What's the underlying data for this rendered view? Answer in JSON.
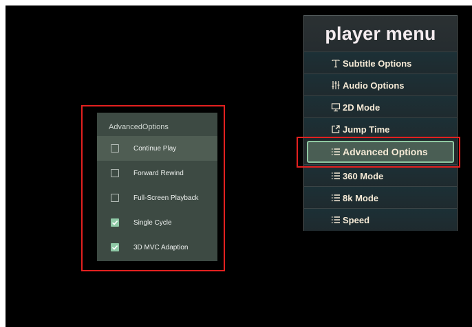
{
  "advanced_options": {
    "title": "AdvancedOptions",
    "items": [
      {
        "label": "Continue Play",
        "checked": false,
        "selected": true
      },
      {
        "label": "Forward Rewind",
        "checked": false,
        "selected": false
      },
      {
        "label": "Full-Screen Playback",
        "checked": false,
        "selected": false
      },
      {
        "label": "Single Cycle",
        "checked": true,
        "selected": false
      },
      {
        "label": "3D MVC Adaption",
        "checked": true,
        "selected": false
      }
    ]
  },
  "player_menu": {
    "title": "player menu",
    "items": [
      {
        "label": "Subtitle Options",
        "icon": "text-t-icon"
      },
      {
        "label": "Audio Options",
        "icon": "equalizer-icon"
      },
      {
        "label": "2D Mode",
        "icon": "monitor-icon"
      },
      {
        "label": "Jump Time",
        "icon": "external-link-icon"
      },
      {
        "label": "Advanced Options",
        "icon": "list-icon",
        "active": true
      },
      {
        "label": "360 Mode",
        "icon": "list-icon"
      },
      {
        "label": "8k Mode",
        "icon": "list-icon"
      },
      {
        "label": "Speed",
        "icon": "list-icon"
      }
    ]
  },
  "colors": {
    "highlight_box": "#e3201f",
    "check_accent": "#8fc9a6",
    "menu_active_border": "#8fc8a2"
  }
}
